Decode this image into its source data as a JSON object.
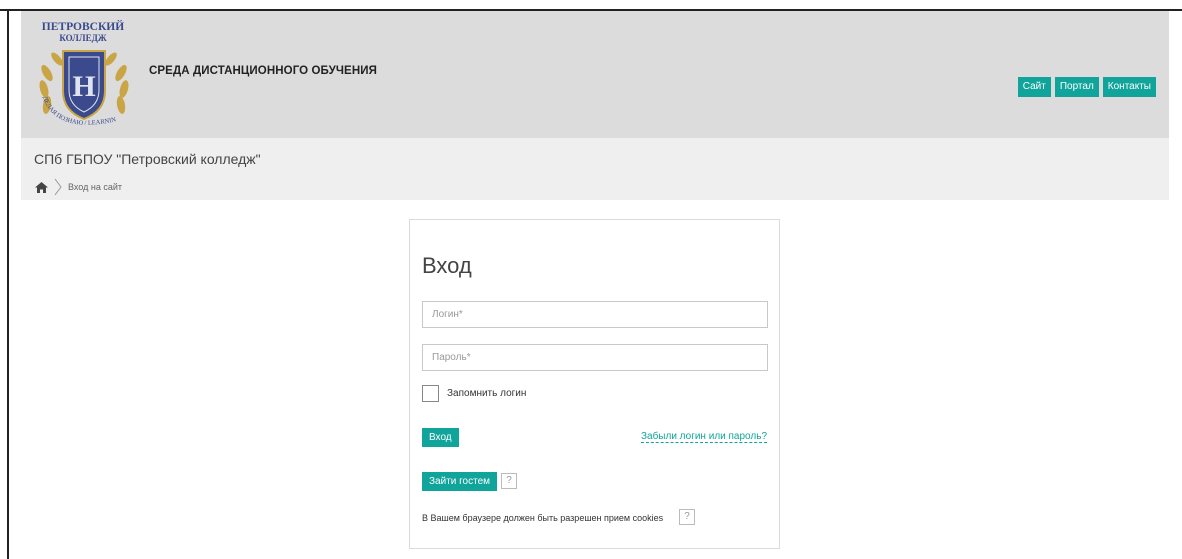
{
  "header": {
    "logo": {
      "name_line1": "ПЕТРОВСКИЙ",
      "name_line2": "КОЛЛЕДЖ",
      "motto": "ДЕЛАЯ ПОЗНАЮ / LEARNING BY DOING",
      "icon": "college-crest-icon"
    },
    "site_title": "СРЕДА ДИСТАНЦИОННОГО ОБУЧЕНИЯ",
    "nav": [
      "Сайт",
      "Портал",
      "Контакты"
    ]
  },
  "org_name": "СПб ГБПОУ \"Петровский колледж\"",
  "breadcrumb": {
    "home_icon": "home-icon",
    "current": "Вход на сайт"
  },
  "login": {
    "title": "Вход",
    "username_placeholder": "Логин*",
    "username_value": "",
    "password_placeholder": "Пароль*",
    "password_value": "",
    "remember_label": "Запомнить логин",
    "remember_checked": false,
    "submit_label": "Вход",
    "forgot_link": "Забыли логин или пароль?",
    "guest_label": "Зайти гостем",
    "help_glyph": "?",
    "cookies_text": "В Вашем браузере должен быть разрешен прием cookies"
  },
  "colors": {
    "accent": "#10a49b",
    "header_bg": "#dcdcdc",
    "subbar_bg": "#efefef",
    "crest_blue": "#3b4a8c",
    "crest_gold": "#c9a545"
  }
}
